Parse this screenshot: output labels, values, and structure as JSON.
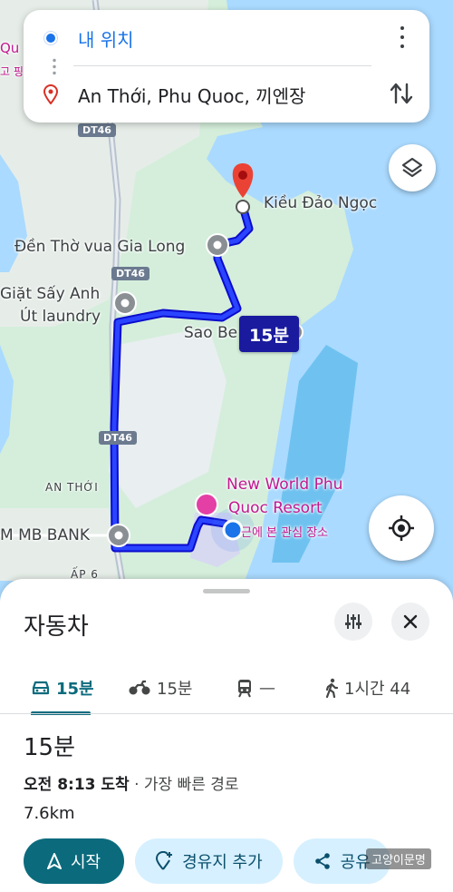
{
  "search": {
    "origin": "내 위치",
    "destination": "An Thới, Phu Quoc, 끼엔장"
  },
  "map": {
    "labels": {
      "kieu_dao_ngoc": "Kiều Đảo Ngọc",
      "den_tho": "Đền Thờ vua Gia Long",
      "giat_say_1": "Giặt Sấy Anh",
      "giat_say_2": "Út laundry",
      "sao_be": "Sao Be",
      "an_thoi": "AN THỚI",
      "mb_bank": "M MB BANK",
      "new_world_1": "New World Phu",
      "new_world_2": "Quoc Resort",
      "recent_place": "근에 본 관심 장소",
      "edge_q": "Qu",
      "edge_ko": "고 핑",
      "edge_ap": "ẤP 6"
    },
    "roads": {
      "dt46_top": "DT46",
      "dt46_mid": "DT46",
      "dt46_low": "DT46"
    },
    "route_badge": "15분"
  },
  "sheet": {
    "title": "자동차",
    "modes": [
      {
        "icon": "car-icon",
        "label": "15분"
      },
      {
        "icon": "motorcycle-icon",
        "label": "15분"
      },
      {
        "icon": "transit-icon",
        "label": "—"
      },
      {
        "icon": "walk-icon",
        "label": "1시간 44"
      }
    ],
    "duration": "15분",
    "arrival": "오전 8:13 도착",
    "arrival_note": " · 가장 빠른 경로",
    "distance": "7.6km",
    "actions": {
      "start": "시작",
      "add_stop": "경유지 추가",
      "share": "공유"
    }
  },
  "watermark": "고양이문명",
  "colors": {
    "accent": "#0b6b7d",
    "route": "#1a1aff",
    "water": "#aadaff",
    "land": "#cdebd5"
  }
}
